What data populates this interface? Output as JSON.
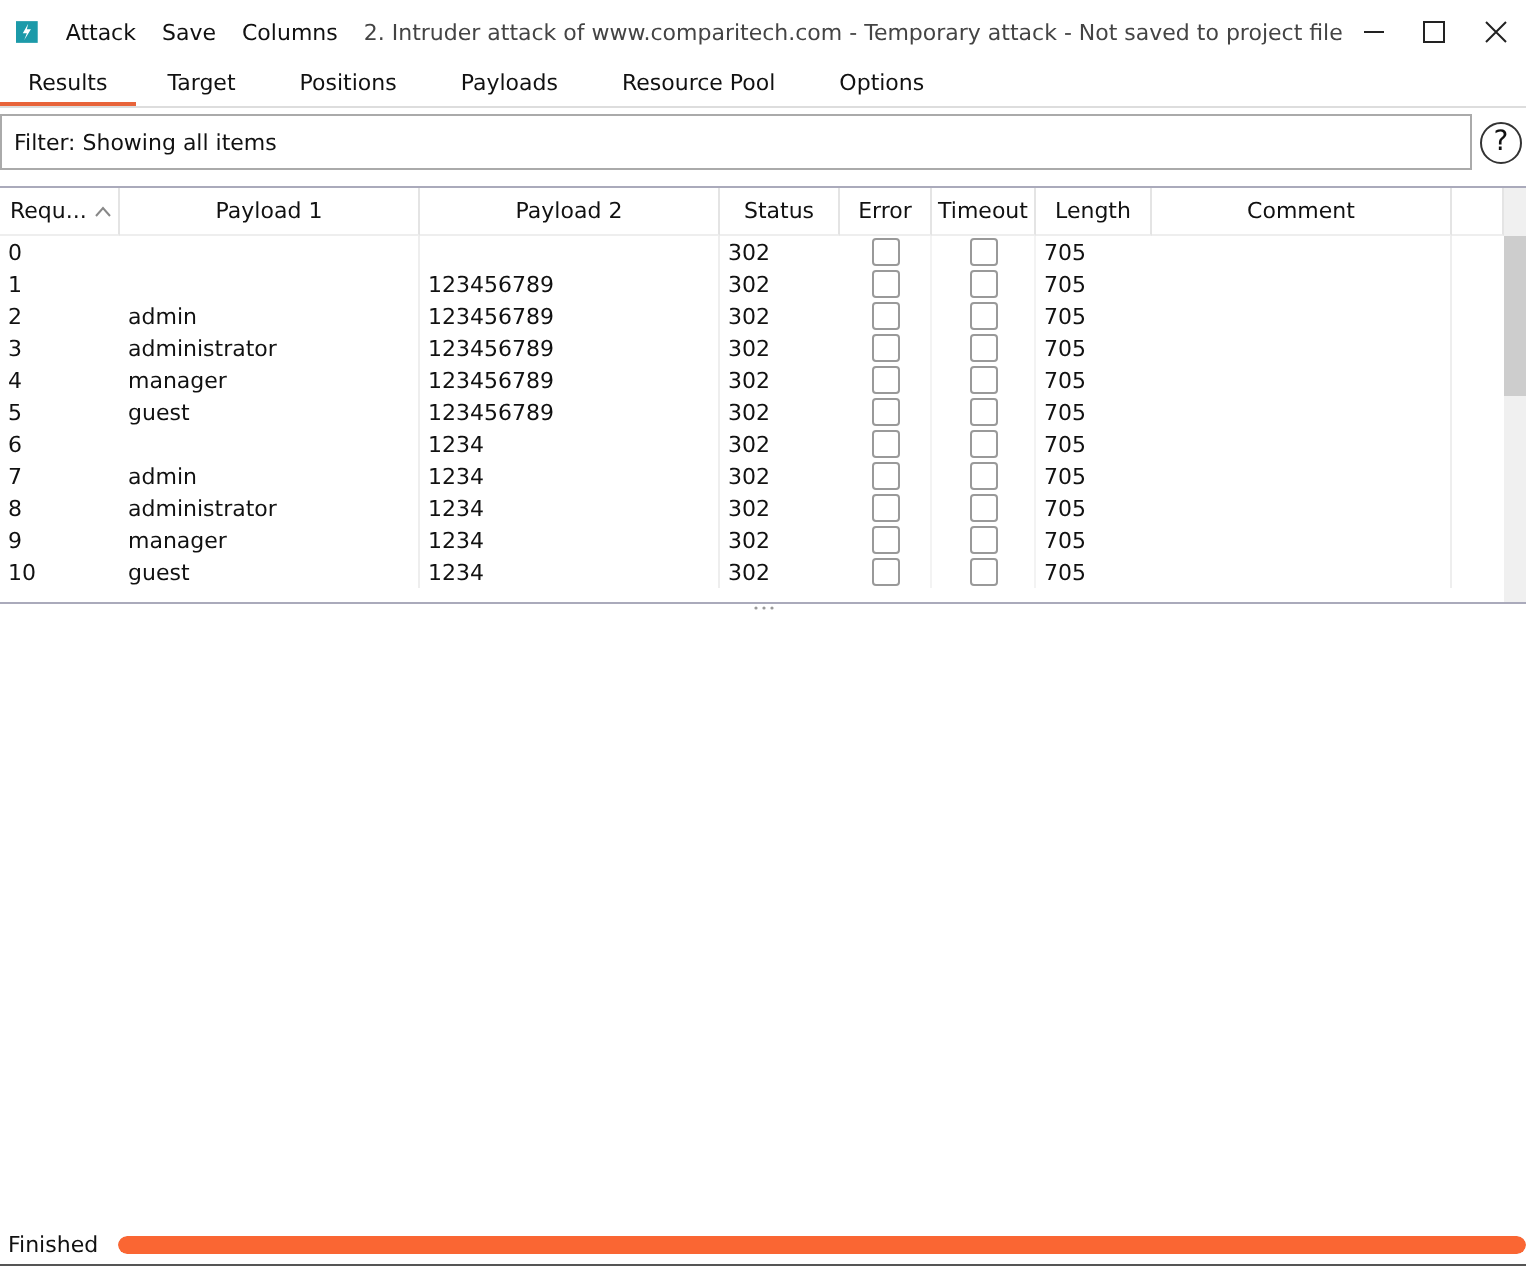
{
  "window": {
    "menu": [
      "Attack",
      "Save",
      "Columns"
    ],
    "title": "2. Intruder attack of www.comparitech.com - Temporary attack - Not saved to project file"
  },
  "tabs": [
    {
      "label": "Results",
      "selected": true
    },
    {
      "label": "Target",
      "selected": false
    },
    {
      "label": "Positions",
      "selected": false
    },
    {
      "label": "Payloads",
      "selected": false
    },
    {
      "label": "Resource Pool",
      "selected": false
    },
    {
      "label": "Options",
      "selected": false
    }
  ],
  "filter": {
    "value": "Filter: Showing all items",
    "help": "?"
  },
  "table": {
    "columns": [
      "Requ...",
      "Payload 1",
      "Payload 2",
      "Status",
      "Error",
      "Timeout",
      "Length",
      "Comment"
    ],
    "rows": [
      {
        "request": "0",
        "payload_1": "",
        "payload_2": "",
        "status": "302",
        "error": false,
        "timeout": false,
        "length": "705"
      },
      {
        "request": "1",
        "payload_1": "",
        "payload_2": "123456789",
        "status": "302",
        "error": false,
        "timeout": false,
        "length": "705"
      },
      {
        "request": "2",
        "payload_1": "admin",
        "payload_2": "123456789",
        "status": "302",
        "error": false,
        "timeout": false,
        "length": "705"
      },
      {
        "request": "3",
        "payload_1": "administrator",
        "payload_2": "123456789",
        "status": "302",
        "error": false,
        "timeout": false,
        "length": "705"
      },
      {
        "request": "4",
        "payload_1": "manager",
        "payload_2": "123456789",
        "status": "302",
        "error": false,
        "timeout": false,
        "length": "705"
      },
      {
        "request": "5",
        "payload_1": "guest",
        "payload_2": "123456789",
        "status": "302",
        "error": false,
        "timeout": false,
        "length": "705"
      },
      {
        "request": "6",
        "payload_1": "",
        "payload_2": "1234",
        "status": "302",
        "error": false,
        "timeout": false,
        "length": "705"
      },
      {
        "request": "7",
        "payload_1": "admin",
        "payload_2": "1234",
        "status": "302",
        "error": false,
        "timeout": false,
        "length": "705"
      },
      {
        "request": "8",
        "payload_1": "administrator",
        "payload_2": "1234",
        "status": "302",
        "error": false,
        "timeout": false,
        "length": "705"
      },
      {
        "request": "9",
        "payload_1": "manager",
        "payload_2": "1234",
        "status": "302",
        "error": false,
        "timeout": false,
        "length": "705"
      },
      {
        "request": "10",
        "payload_1": "guest",
        "payload_2": "1234",
        "status": "302",
        "error": false,
        "timeout": false,
        "length": "705"
      }
    ]
  },
  "status_bar": {
    "text": "Finished",
    "level": 1
  }
}
